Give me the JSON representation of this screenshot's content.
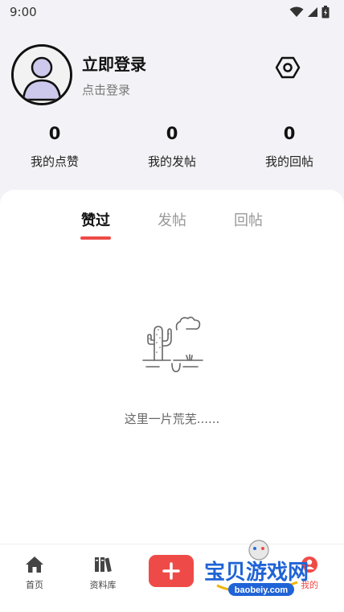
{
  "status_bar": {
    "time": "9:00"
  },
  "profile": {
    "title": "立即登录",
    "subtitle": "点击登录"
  },
  "stats": [
    {
      "value": "0",
      "label": "我的点赞"
    },
    {
      "value": "0",
      "label": "我的发帖"
    },
    {
      "value": "0",
      "label": "我的回帖"
    }
  ],
  "tabs": [
    {
      "label": "赞过"
    },
    {
      "label": "发帖"
    },
    {
      "label": "回帖"
    }
  ],
  "empty_state": {
    "text": "这里一片荒芜......"
  },
  "bottom_nav": [
    {
      "label": "首页",
      "icon": "home-icon"
    },
    {
      "label": "资料库",
      "icon": "library-icon"
    },
    {
      "label": "",
      "icon": "plus-icon"
    },
    {
      "label": "我的",
      "icon": "profile-icon"
    }
  ],
  "watermark": {
    "text": "宝贝游戏网",
    "url_text": "baobeiy.com"
  },
  "colors": {
    "accent": "#ee4b48",
    "background": "#f3f3f7",
    "card": "#ffffff"
  }
}
